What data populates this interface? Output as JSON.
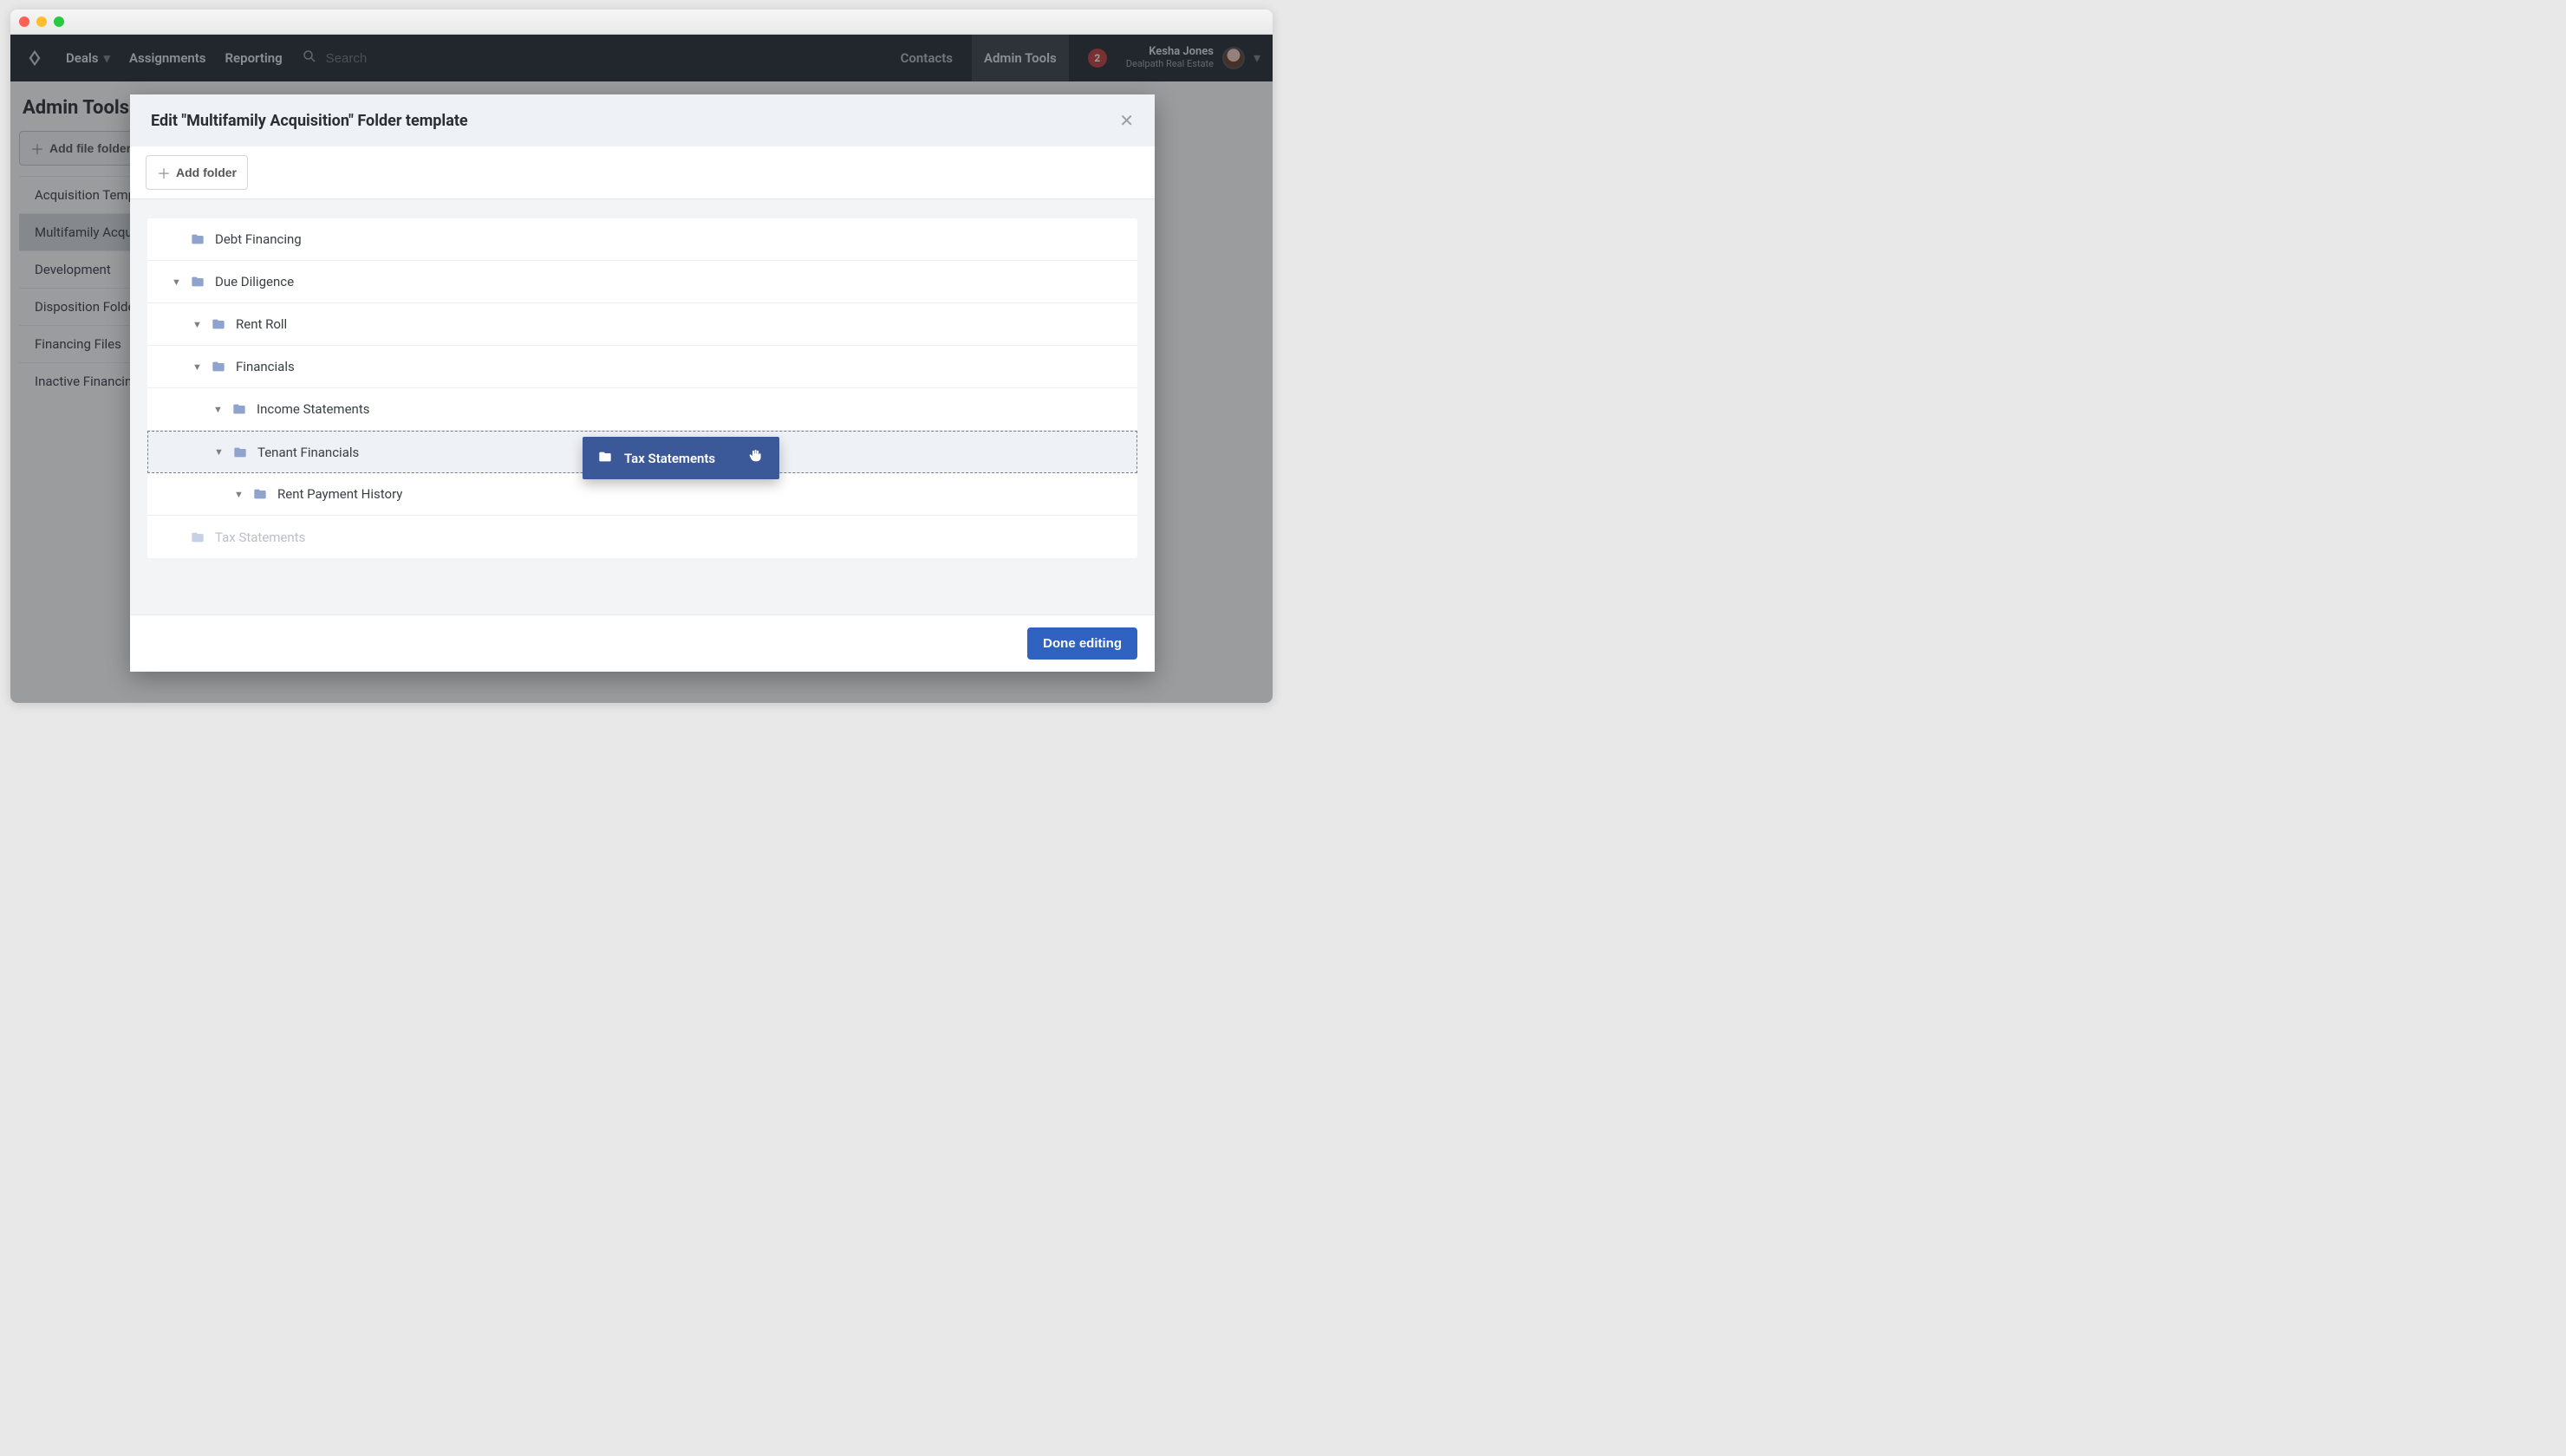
{
  "nav": {
    "deals": "Deals",
    "assignments": "Assignments",
    "reporting": "Reporting",
    "search_placeholder": "Search",
    "contacts": "Contacts",
    "admin_tools": "Admin Tools",
    "notif_count": "2"
  },
  "user": {
    "name": "Kesha Jones",
    "org": "Dealpath Real Estate"
  },
  "page": {
    "title": "Admin Tools",
    "add_file_folder": "Add file folder"
  },
  "sidebar": {
    "items": [
      {
        "label": "Acquisition Template"
      },
      {
        "label": "Multifamily Acquisition"
      },
      {
        "label": "Development"
      },
      {
        "label": "Disposition Folder"
      },
      {
        "label": "Financing Files"
      },
      {
        "label": "Inactive Financing"
      }
    ]
  },
  "modal": {
    "title_prefix": "Edit ",
    "title_quote": "\"Multifamily Acquisition\"",
    "title_suffix": " Folder template",
    "add_folder": "Add folder",
    "done": "Done editing"
  },
  "tree": {
    "r0": "Debt Financing",
    "r1": "Due Diligence",
    "r2": "Rent Roll",
    "r3": "Financials",
    "r4": "Income Statements",
    "r5": "Tenant Financials",
    "r6": "Rent Payment History",
    "r7": "Tax Statements"
  },
  "drag": {
    "label": "Tax Statements"
  }
}
